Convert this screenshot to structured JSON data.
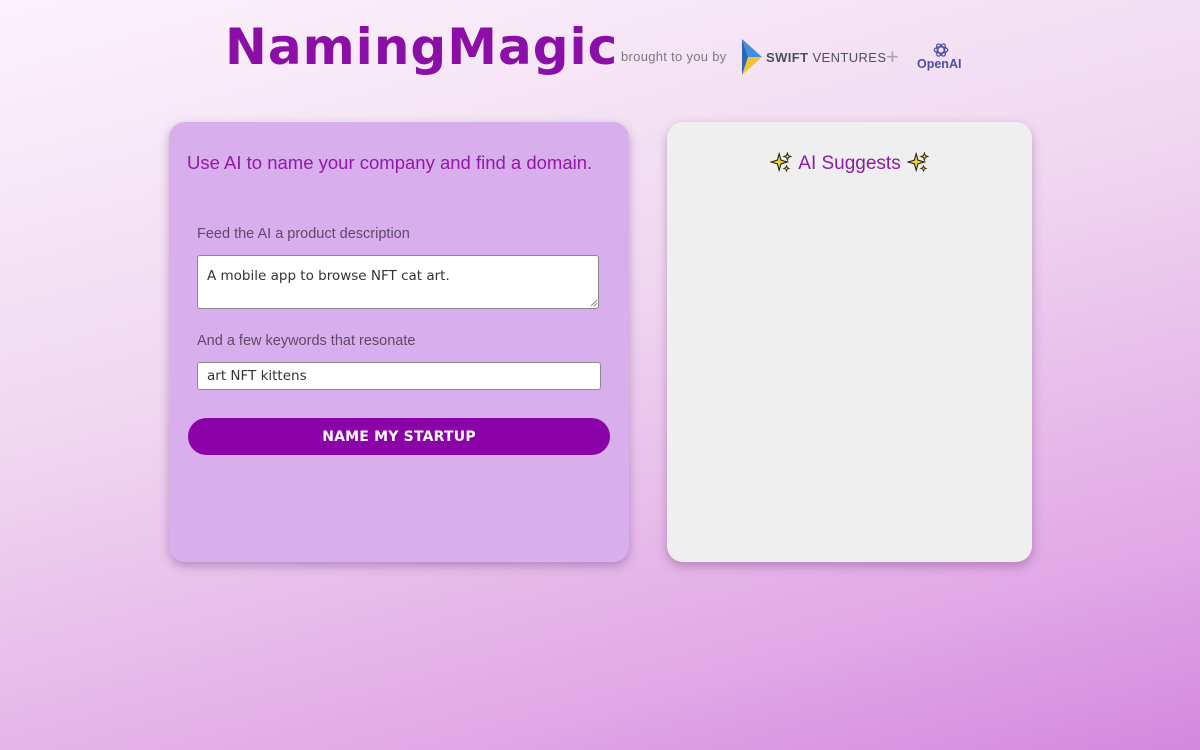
{
  "header": {
    "brand": "NamingMagic",
    "byline": "brought to you by",
    "partner1_bold": "SWIFT",
    "partner1_rest": " VENTURES",
    "plus": "+",
    "partner2": "OpenAI"
  },
  "form": {
    "tagline": "Use AI to name your company and find a domain.",
    "description_label": "Feed the AI a product description",
    "description_value": "A mobile app to browse NFT cat art.",
    "keywords_label": "And a few keywords that resonate",
    "keywords_value": "art NFT kittens",
    "submit_label": "NAME MY STARTUP"
  },
  "suggestions": {
    "title": "AI Suggests",
    "icon": "sparkles-icon"
  },
  "colors": {
    "accent": "#8a02a8",
    "left_card": "#d9aeed",
    "right_card": "#efefef"
  }
}
